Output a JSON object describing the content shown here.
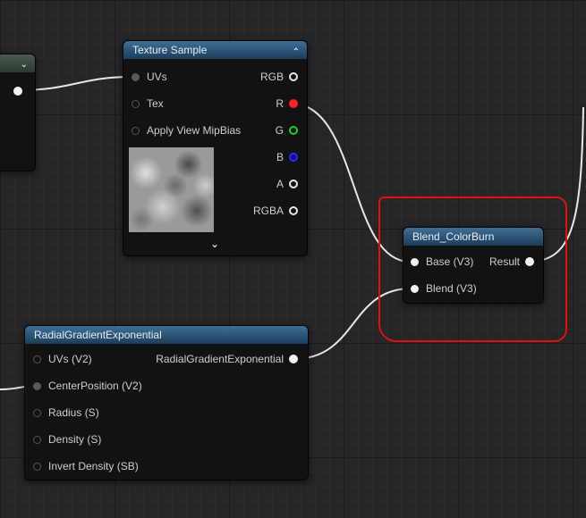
{
  "colors": {
    "header_accent": "#2f5678",
    "node_bg": "#121212",
    "pin_red": "#ff2020",
    "pin_green": "#1fcf2f",
    "pin_blue": "#2a2aff",
    "annotation": "#e01010"
  },
  "texture_sample": {
    "title": "Texture Sample",
    "inputs": [
      "UVs",
      "Tex",
      "Apply View MipBias"
    ],
    "outputs": [
      "RGB",
      "R",
      "G",
      "B",
      "A",
      "RGBA"
    ],
    "expand_icon": "chevron-down-icon",
    "collapse_icon": "chevron-up-icon"
  },
  "blend_node": {
    "title": "Blend_ColorBurn",
    "inputs": [
      "Base (V3)",
      "Blend (V3)"
    ],
    "outputs": [
      "Result"
    ]
  },
  "radial_node": {
    "title": "RadialGradientExponential",
    "inputs": [
      "UVs (V2)",
      "CenterPosition (V2)",
      "Radius (S)",
      "Density (S)",
      "Invert Density (SB)"
    ],
    "outputs": [
      "RadialGradientExponential"
    ]
  }
}
